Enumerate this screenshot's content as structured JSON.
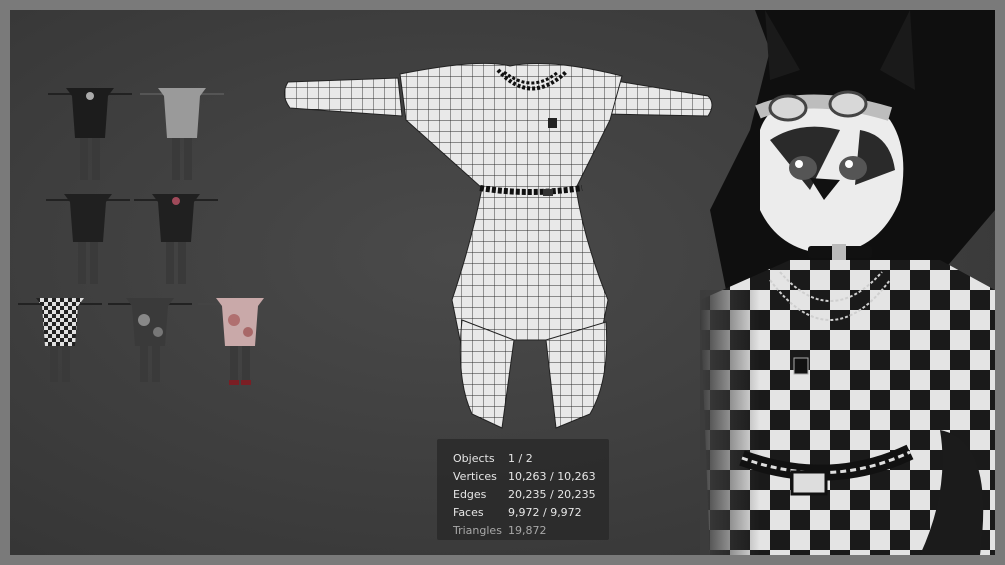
{
  "viewport": {
    "background": "#3e3e3e",
    "outfit_thumbnails": [
      {
        "name": "black-outfit-1",
        "color": "#1c1c1c"
      },
      {
        "name": "grey-outfit",
        "color": "#9a9a9a"
      },
      {
        "name": "black-outfit-2",
        "color": "#202020"
      },
      {
        "name": "black-outfit-3",
        "color": "#202020"
      },
      {
        "name": "checker-outfit",
        "color": "#cfcfcf"
      },
      {
        "name": "dark-floral-outfit",
        "color": "#3a3a3a"
      },
      {
        "name": "pink-floral-outfit",
        "color": "#c9a9a9"
      }
    ]
  },
  "stats": {
    "objects": {
      "label": "Objects",
      "value": "1 / 2"
    },
    "vertices": {
      "label": "Vertices",
      "value": "10,263 / 10,263"
    },
    "edges": {
      "label": "Edges",
      "value": "20,235 / 20,235"
    },
    "faces": {
      "label": "Faces",
      "value": "9,972 / 9,972"
    },
    "triangles": {
      "label": "Triangles",
      "value": "19,872"
    }
  }
}
